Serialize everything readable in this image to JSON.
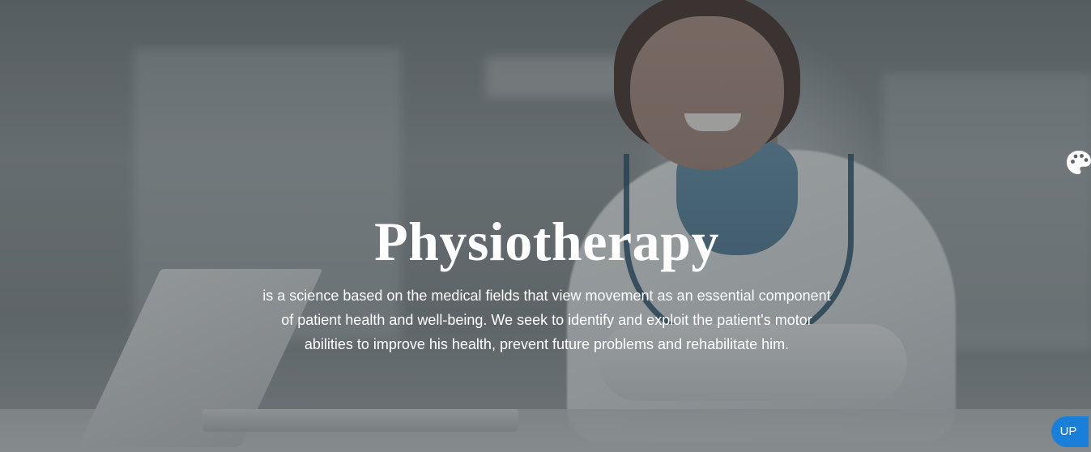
{
  "hero": {
    "title": "Physiotherapy",
    "description": "is a science based on the medical fields that view movement as an essential component of patient health and well-being. We seek to identify and exploit the patient's motor abilities to improve his health, prevent future problems and rehabilitate him."
  },
  "controls": {
    "palette_icon": "palette-icon",
    "up_label": "UP"
  },
  "colors": {
    "overlay": "#343a3c",
    "text": "#ffffff",
    "up_button": "#1a7fd9"
  }
}
